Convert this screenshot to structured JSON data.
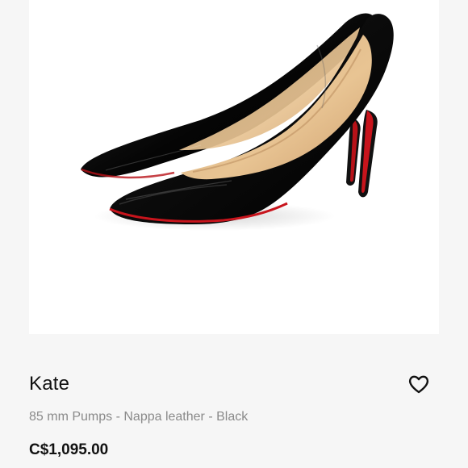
{
  "product": {
    "name": "Kate",
    "description": "85 mm Pumps - Nappa leather - Black",
    "price": "C$1,095.00",
    "wishlist_icon": "heart-outline-icon"
  },
  "colors": {
    "page_background": "#f6f6f6",
    "card_background": "#ffffff",
    "title_text": "#111111",
    "subtitle_text": "#8a8a8a",
    "sole_red": "#c8141c"
  }
}
